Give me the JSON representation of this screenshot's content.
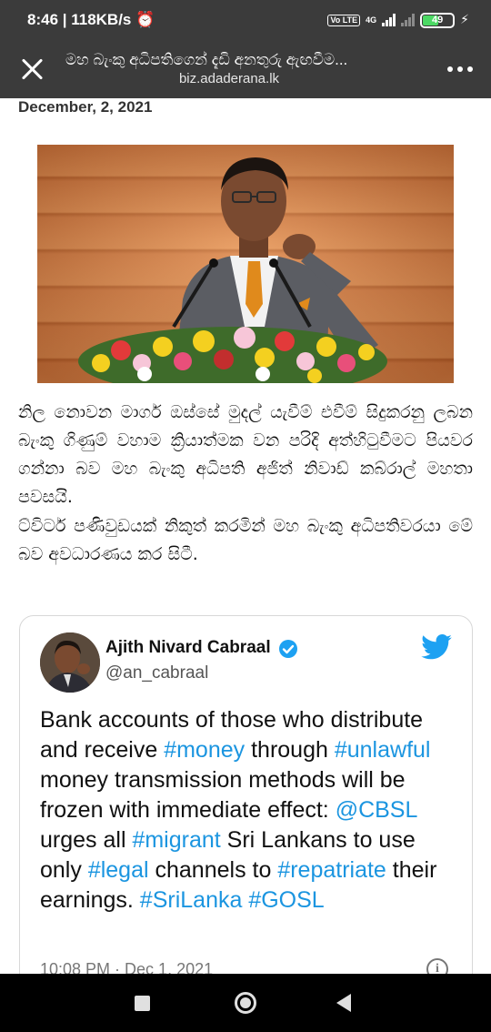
{
  "status_bar": {
    "time": "8:46",
    "speed": "118KB/s",
    "volte": "Vo LTE",
    "network": "4G",
    "battery": "49",
    "battery_level": 0.49
  },
  "browser": {
    "title": "මහ බැංකු අධිපතිගෙන් දැඩි අනතුරු ඇඟවීම...",
    "url": "biz.adaderana.lk"
  },
  "article": {
    "date": "December, 2, 2021",
    "paragraphs": [
      "නිල නොවන මාර්ග ඔස්සේ මුදල් යැවීම් එවීම් සිදුකරනු ලබන බැංකු ගිණුම් වහාම ක්‍රියාත්මක වන පරිදි අත්හිටුවීමට පියවර ගන්නා බව මහ බැංකු අධිපති අජිත් නිවාඩ් කබ්රාල් මහතා පවසයි.",
      "ට්විටර් පණිවුඩයක් නිකුත් කරමින් මහ බැංකු අධිපතිවරයා මේ බව අවධාරණය කර සිටී."
    ]
  },
  "tweet": {
    "name": "Ajith Nivard Cabraal",
    "handle": "@an_cabraal",
    "text_parts": {
      "t1": "Bank accounts of those who distribute and receive ",
      "h1": "#money",
      "t2": " through ",
      "h2": "#unlawful",
      "t3": " money transmission methods will be frozen with immediate effect: ",
      "h3": "@CBSL",
      "t4": " urges all ",
      "h4": "#migrant",
      "t5": " Sri Lankans to use only ",
      "h5": "#legal",
      "t6": " channels to ",
      "h6": "#repatriate",
      "t7": " their earnings. ",
      "h7": "#SriLanka",
      "t8": " ",
      "h8": "#GOSL"
    },
    "timestamp": "10:08 PM · Dec 1, 2021",
    "info_glyph": "i"
  },
  "colors": {
    "bar_bg": "#3b3b3b",
    "link": "#1b95e0",
    "twitter_blue": "#1da1f2",
    "battery_green": "#4cd964"
  },
  "icons": [
    "close-icon",
    "more-icon",
    "verified-icon",
    "twitter-bird-icon",
    "info-icon",
    "recents-icon",
    "home-icon",
    "back-icon"
  ]
}
